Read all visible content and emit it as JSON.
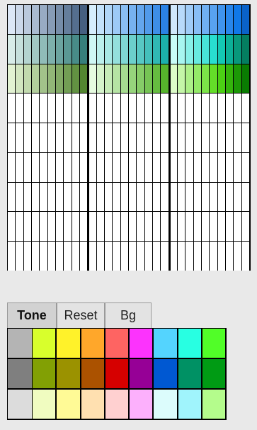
{
  "window": {
    "background": "#e9e9e9"
  },
  "palette": {
    "gradient_rows": [
      {
        "name": "blue-slate",
        "colors": [
          "#dce7f6",
          "#cbd8ea",
          "#bac9dd",
          "#a9bad0",
          "#98abc3",
          "#879cb6",
          "#768da9",
          "#657e9c",
          "#556f8f",
          "#465f80",
          "#d6eefd",
          "#c3e2fb",
          "#b0d6f8",
          "#9dcaf6",
          "#8abef3",
          "#77b2f0",
          "#64a6ed",
          "#519aea",
          "#3e8ee7",
          "#2b82e4",
          "#d0e8fc",
          "#b8dafa",
          "#a0ccf7",
          "#88bef5",
          "#70b0f2",
          "#58a2f0",
          "#4094ed",
          "#2886eb",
          "#1078e8",
          "#0a62c8"
        ]
      },
      {
        "name": "teal-gray",
        "colors": [
          "#d8ece8",
          "#c6e0dc",
          "#b4d4d0",
          "#a2c8c4",
          "#90bcb8",
          "#7eb0ac",
          "#6ca4a0",
          "#5a9894",
          "#488c88",
          "#367f7b",
          "#d0f8f4",
          "#bcf0ec",
          "#a8e8e4",
          "#94e0dc",
          "#80d8d4",
          "#6cd0cc",
          "#58c8c4",
          "#44c0bc",
          "#30b8b4",
          "#1cb0ac",
          "#c8fcf8",
          "#a8f6f0",
          "#88f0e8",
          "#68eae0",
          "#48e4d8",
          "#28ded0",
          "#14c8b4",
          "#0cb098",
          "#08987c",
          "#047e60"
        ]
      },
      {
        "name": "green",
        "colors": [
          "#e2f2d2",
          "#d2e6c0",
          "#c2daae",
          "#b2ce9c",
          "#a2c28a",
          "#92b678",
          "#82aa66",
          "#729e54",
          "#629242",
          "#528630",
          "#e6fce0",
          "#d6f4cc",
          "#c6ecb8",
          "#b6e4a4",
          "#a6dc90",
          "#96d47c",
          "#86cc68",
          "#76c454",
          "#66bc40",
          "#56b42c",
          "#dcfcc8",
          "#c4f6a8",
          "#acf088",
          "#94ea68",
          "#7ce448",
          "#64de28",
          "#4cd014",
          "#34b40c",
          "#1c9806",
          "#0a7c02"
        ]
      }
    ],
    "empty_cell_color": "#ffffff",
    "empty_rows": 6
  },
  "tabs": [
    {
      "key": "tone",
      "label": "Tone",
      "active": true
    },
    {
      "key": "reset",
      "label": "Reset",
      "active": false
    },
    {
      "key": "bg",
      "label": "Bg",
      "active": false
    }
  ],
  "swatches": {
    "rows": [
      [
        "#b4b4b4",
        "#d8ff2c",
        "#fff22a",
        "#ffa72a",
        "#fe6462",
        "#fc33fd",
        "#54d4fe",
        "#28ffe2",
        "#51fe28"
      ],
      [
        "#7f7f7f",
        "#82a004",
        "#9b9200",
        "#ab5200",
        "#d60000",
        "#960096",
        "#0058d2",
        "#009164",
        "#009b14"
      ],
      [
        "#dcdcdc",
        "#f0fcc0",
        "#fffa96",
        "#ffe0b0",
        "#ffd0d0",
        "#fcb0fc",
        "#dcfcfc",
        "#a0f4fc",
        "#b4fc8c"
      ]
    ]
  }
}
